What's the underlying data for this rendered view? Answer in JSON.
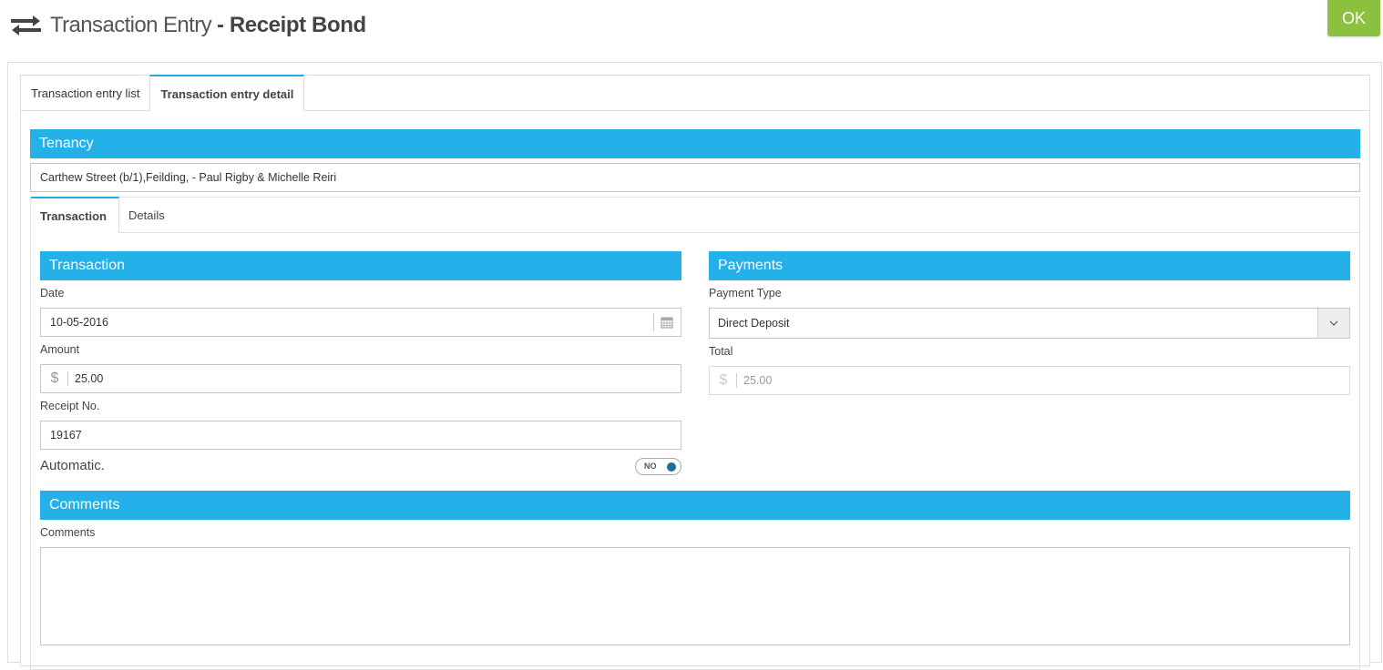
{
  "header": {
    "title_main": "Transaction Entry",
    "title_sub": "- Receipt Bond",
    "icon": "exchange-icon",
    "ok_label": "OK"
  },
  "main_tabs": [
    {
      "label": "Transaction entry list",
      "active": false
    },
    {
      "label": "Transaction entry detail",
      "active": true
    }
  ],
  "tenancy": {
    "section_title": "Tenancy",
    "value": "Carthew Street (b/1),Feilding, - Paul Rigby & Michelle Reiri"
  },
  "sub_tabs": [
    {
      "label": "Transaction",
      "active": true
    },
    {
      "label": "Details",
      "active": false
    }
  ],
  "transaction": {
    "section_title": "Transaction",
    "date_label": "Date",
    "date_value": "10-05-2016",
    "amount_label": "Amount",
    "currency_symbol": "$",
    "amount_value": "25.00",
    "receipt_label": "Receipt No.",
    "receipt_value": "19167",
    "automatic_label": "Automatic.",
    "automatic_toggle": "NO"
  },
  "payments": {
    "section_title": "Payments",
    "payment_type_label": "Payment Type",
    "payment_type_value": "Direct Deposit",
    "total_label": "Total",
    "currency_symbol": "$",
    "total_value": "25.00"
  },
  "comments": {
    "section_title": "Comments",
    "label": "Comments",
    "value": ""
  },
  "colors": {
    "accent": "#24b0e8",
    "ok_button": "#8cc13f",
    "toggle_knob": "#1e6f96"
  }
}
